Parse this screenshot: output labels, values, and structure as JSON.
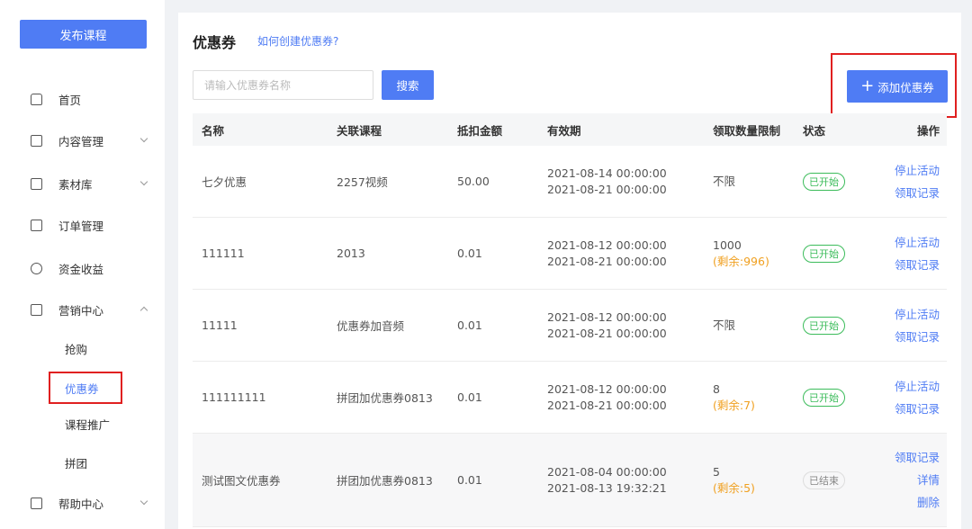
{
  "sidebar": {
    "publish_label": "发布课程",
    "items": [
      {
        "label": "首页",
        "icon": "home-icon"
      },
      {
        "label": "内容管理",
        "icon": "content-icon"
      },
      {
        "label": "素材库",
        "icon": "folder-icon"
      },
      {
        "label": "订单管理",
        "icon": "order-icon"
      },
      {
        "label": "资金收益",
        "icon": "money-icon"
      },
      {
        "label": "营销中心",
        "icon": "marketing-icon"
      },
      {
        "label": "帮助中心",
        "icon": "help-icon"
      }
    ],
    "sub_items": [
      "抢购",
      "优惠券",
      "课程推广",
      "拼团"
    ]
  },
  "header": {
    "title": "优惠券",
    "help_link": "如何创建优惠券?"
  },
  "search": {
    "placeholder": "请输入优惠券名称",
    "button": "搜索"
  },
  "add_button": "添加优惠券",
  "table": {
    "columns": [
      "名称",
      "关联课程",
      "抵扣金额",
      "有效期",
      "领取数量限制",
      "状态",
      "操作"
    ],
    "rows": [
      {
        "name": "七夕优惠",
        "course": "2257视频",
        "amount": "50.00",
        "start": "2021-08-14 00:00:00",
        "end": "2021-08-21 00:00:00",
        "limit": "不限",
        "remain": "",
        "status": "已开始",
        "ops": [
          "停止活动",
          "领取记录"
        ]
      },
      {
        "name": "111111",
        "course": "2013",
        "amount": "0.01",
        "start": "2021-08-12 00:00:00",
        "end": "2021-08-21 00:00:00",
        "limit": "1000",
        "remain": "(剩余:996)",
        "status": "已开始",
        "ops": [
          "停止活动",
          "领取记录"
        ]
      },
      {
        "name": "11111",
        "course": "优惠券加音频",
        "amount": "0.01",
        "start": "2021-08-12 00:00:00",
        "end": "2021-08-21 00:00:00",
        "limit": "不限",
        "remain": "",
        "status": "已开始",
        "ops": [
          "停止活动",
          "领取记录"
        ]
      },
      {
        "name": "111111111",
        "course": "拼团加优惠券0813",
        "amount": "0.01",
        "start": "2021-08-12 00:00:00",
        "end": "2021-08-21 00:00:00",
        "limit": "8",
        "remain": "(剩余:7)",
        "status": "已开始",
        "ops": [
          "停止活动",
          "领取记录"
        ]
      },
      {
        "name": "测试图文优惠券",
        "course": "拼团加优惠券0813",
        "amount": "0.01",
        "start": "2021-08-04 00:00:00",
        "end": "2021-08-13 19:32:21",
        "limit": "5",
        "remain": "(剩余:5)",
        "status": "已结束",
        "ops": [
          "领取记录",
          "详情",
          "删除"
        ]
      }
    ]
  },
  "colors": {
    "accent": "#4f7cf4",
    "started": "#3cbc5b",
    "remain": "#f0a020",
    "highlight": "#e02020"
  }
}
